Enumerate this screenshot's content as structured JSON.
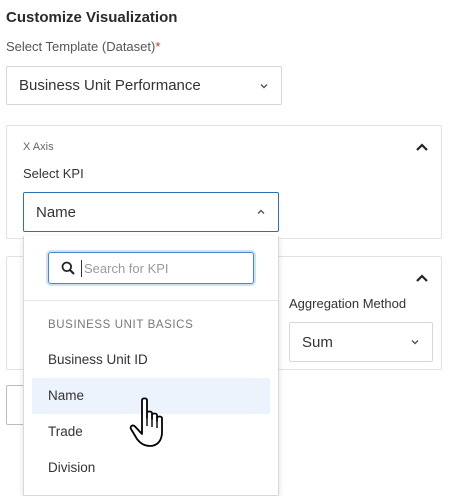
{
  "header": {
    "title": "Customize Visualization"
  },
  "template": {
    "label": "Select Template (Dataset)",
    "required_mark": "*",
    "value": "Business Unit Performance"
  },
  "x_axis": {
    "caption": "X Axis",
    "kpi_label": "Select KPI",
    "kpi_value": "Name"
  },
  "aggregation": {
    "label": "Aggregation Method",
    "value": "Sum"
  },
  "dropdown": {
    "search_placeholder": "Search for KPI",
    "group_header": "BUSINESS UNIT BASICS",
    "items": [
      "Business Unit ID",
      "Name",
      "Trade",
      "Division"
    ],
    "highlighted_index": 1
  },
  "icons": {
    "chevron": "chevron-down-icon",
    "collapse": "chevron-up-icon",
    "search": "search-icon",
    "cursor": "hand-pointer-icon"
  },
  "colors": {
    "focus_border": "#2f6fb3",
    "highlight_bg": "#edf3fc",
    "required": "#d32f2f"
  }
}
